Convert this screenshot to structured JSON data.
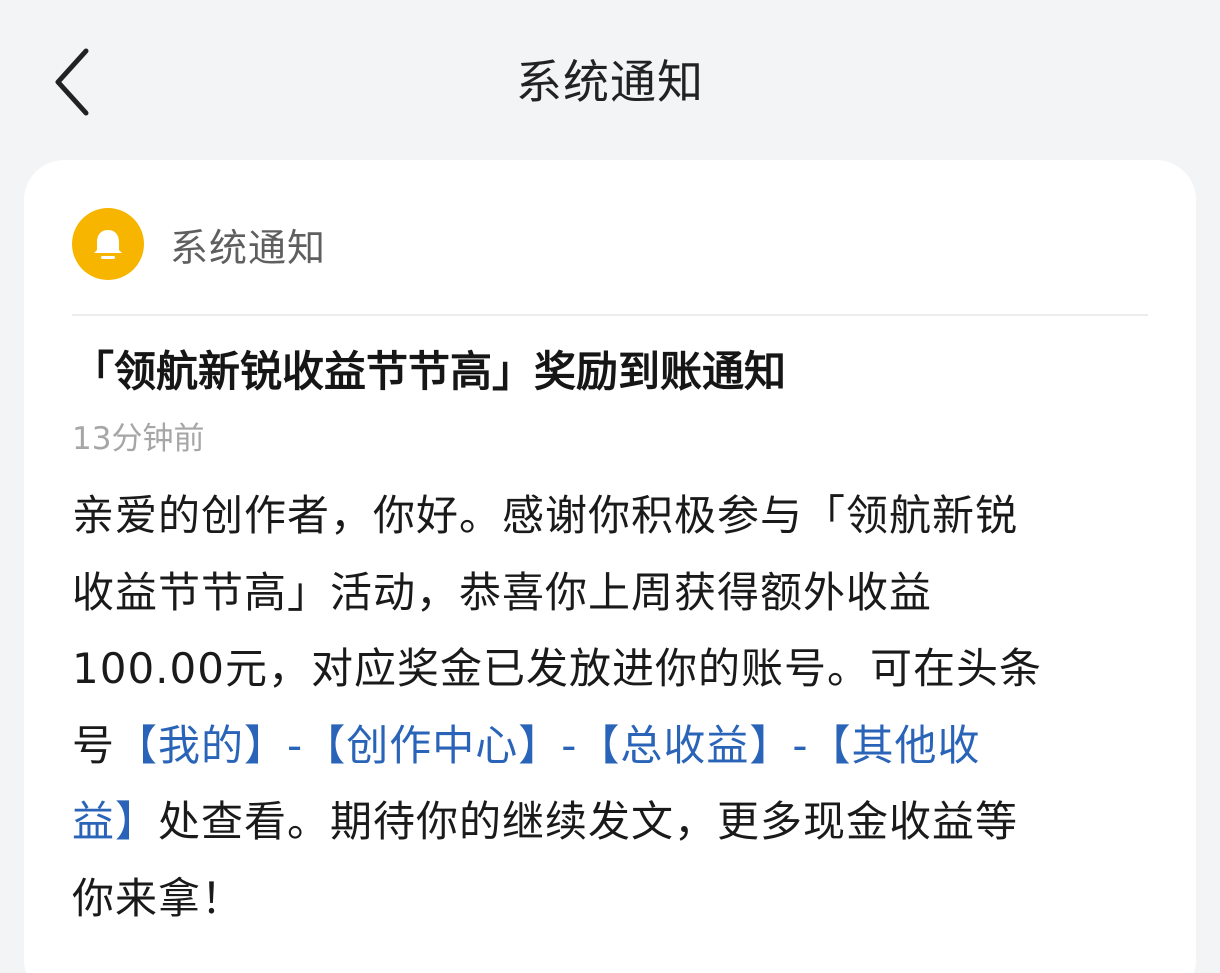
{
  "header": {
    "title": "系统通知",
    "back_icon": "chevron-left-icon"
  },
  "card": {
    "sender": "系统通知",
    "sender_icon": "bell-icon",
    "accent_color": "#f7b500",
    "notice_title": "「领航新锐收益节节高」奖励到账通知",
    "timestamp": "13分钟前",
    "body": {
      "line1": "亲爱的创作者，你好。感谢你积极参与「领航新锐",
      "line2": "收益节节高」活动，恭喜你上周获得额外收益",
      "line3": "100.00元，对应奖金已发放进你的账号。可在头条",
      "prefix": "号",
      "link_mine": "【我的】",
      "sep1": "-",
      "link_creator_center": "【创作中心】",
      "sep2": "-",
      "link_total_income": "【总收益】",
      "sep3": "-",
      "link_other_income_a": "【其他收",
      "link_other_income_b": "益】",
      "tail": "处查看。期待你的继续发文，更多现金收益等",
      "last": "你来拿！"
    },
    "link_color": "#2a64b8"
  }
}
